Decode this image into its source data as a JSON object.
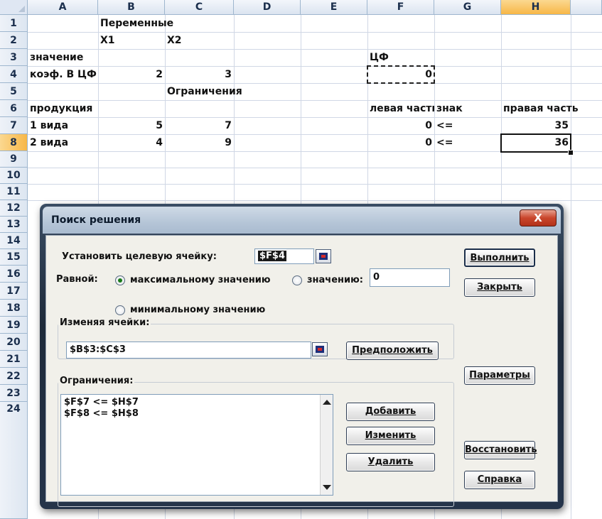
{
  "sheet": {
    "columns": [
      "A",
      "B",
      "C",
      "D",
      "E",
      "F",
      "G",
      "H"
    ],
    "selected_column": "H",
    "rows": [
      "1",
      "2",
      "3",
      "4",
      "5",
      "6",
      "7",
      "8",
      "9",
      "10",
      "11",
      "12",
      "13",
      "14",
      "15",
      "16",
      "17",
      "18",
      "19",
      "20",
      "21",
      "22",
      "23",
      "24"
    ],
    "selected_row": "8",
    "cells": {
      "B1": "Переменные",
      "B2": "X1",
      "C2": "X2",
      "A3": "значение",
      "F3": "ЦФ",
      "A4": "коэф. В ЦФ",
      "B4": "2",
      "C4": "3",
      "F4": "0",
      "C5": "Ограничения",
      "A6": "продукция",
      "F6": "левая часть",
      "G6": "знак",
      "H6": "правая часть",
      "A7": "1 вида",
      "B7": "5",
      "C7": "7",
      "F7": "0",
      "G7": "<=",
      "H7": "35",
      "A8": "2 вида",
      "B8": "4",
      "C8": "9",
      "F8": "0",
      "G8": "<=",
      "H8": "36"
    }
  },
  "dialog": {
    "title": "Поиск решения",
    "close_label": "X",
    "target_cell_label": "Установить целевую ячейку:",
    "target_cell_value": "$F$4",
    "equal_label": "Равной:",
    "radio_max": "максимальному значению",
    "radio_value": "значению:",
    "value_input": "0",
    "radio_min": "минимальному значению",
    "radio_selected": "max",
    "changing_cells_label": "Изменяя ячейки:",
    "changing_cells_value": "$B$3:$C$3",
    "guess_button": "Предположить",
    "constraints_label": "Ограничения:",
    "constraints": [
      "$F$7 <= $H$7",
      "$F$8 <= $H$8"
    ],
    "add_button": "Добавить",
    "change_button": "Изменить",
    "delete_button": "Удалить",
    "solve_button": "Выполнить",
    "close_button": "Закрыть",
    "options_button": "Параметры",
    "reset_button": "Восстановить",
    "help_button": "Справка"
  }
}
